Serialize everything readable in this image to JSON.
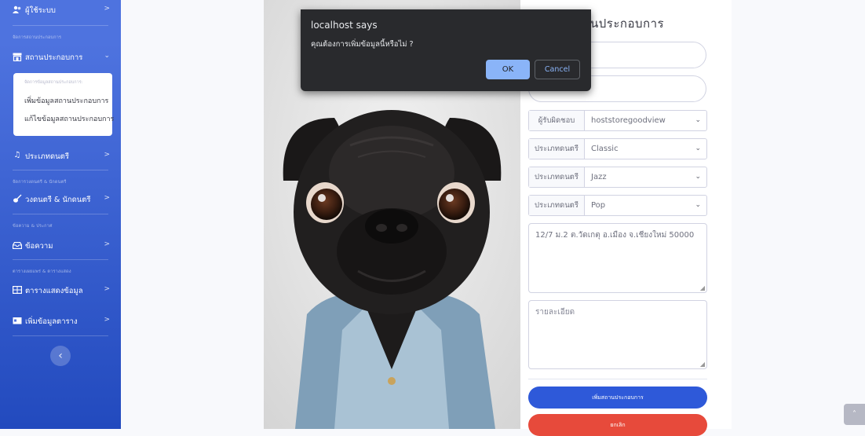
{
  "sidebar": {
    "users_item": {
      "label": "ผู้ใช้ระบบ",
      "icon": "users-icon"
    },
    "heading_venue": "จัดการสถานประกอบการ",
    "venue_item": {
      "label": "สถานประกอบการ",
      "icon": "store-icon"
    },
    "venue_submenu": {
      "header": "จัดการข้อมูลสถานประกอบการ:",
      "items": [
        "เพิ่มข้อมูลสถานประกอบการ",
        "แก้ไขข้อมูลสถานประกอบการ"
      ]
    },
    "music_type_item": {
      "label": "ประเภทดนตรี",
      "icon": "music-icon"
    },
    "heading_band": "จัดการวงดนตรี & นักดนตรี",
    "band_item": {
      "label": "วงดนตรี & นักดนตรี",
      "icon": "guitar-icon"
    },
    "heading_message": "ข้อความ & ประกาศ",
    "message_item": {
      "label": "ข้อความ",
      "icon": "inbox-icon"
    },
    "heading_table": "ตารางเผยแพร่ & ตารางแสดง",
    "table_item": {
      "label": "ตารางแสดงข้อมูล",
      "icon": "table-icon"
    },
    "add_table_item": {
      "label": "เพิ่มข้อมูลตาราง",
      "icon": "calendar-plus-icon"
    }
  },
  "form": {
    "title": "นประกอบการ",
    "owner": {
      "label": "ผู้รับผิดชอบ",
      "value": "hoststoregoodview"
    },
    "music_types": [
      {
        "label": "ประเภทดนตรี",
        "value": "Classic"
      },
      {
        "label": "ประเภทดนตรี",
        "value": "Jazz"
      },
      {
        "label": "ประเภทดนตรี",
        "value": "Pop"
      }
    ],
    "address": "12/7 ม.2 ต.วัดเกตุ อ.เมือง จ.เชียงใหม่ 50000",
    "details_placeholder": "รายละเอียด",
    "submit_label": "เพิ่มสถานประกอบการ",
    "cancel_label": "ยกเลิก"
  },
  "dialog": {
    "title": "localhost says",
    "message": "คุณต้องการเพิ่มข้อมูลนี้หรือไม่ ?",
    "ok_label": "OK",
    "cancel_label": "Cancel"
  },
  "colors": {
    "sidebar_top": "#4e73df",
    "sidebar_bottom": "#224abe",
    "submit_button": "#2e59d9",
    "cancel_button": "#e74a3b",
    "dialog_bg": "#292a2d",
    "dialog_ok": "#8ab4f8"
  }
}
